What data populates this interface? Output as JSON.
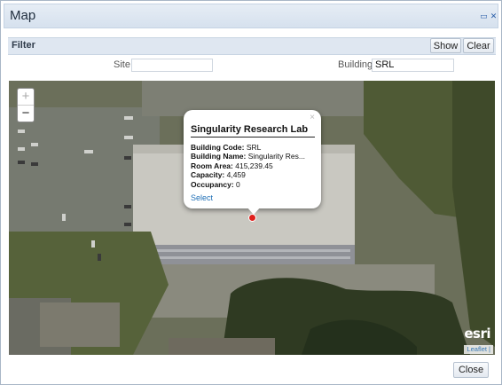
{
  "window": {
    "title": "Map",
    "restore_glyph": "▭",
    "close_glyph": "✕"
  },
  "filter": {
    "label": "Filter",
    "show_label": "Show",
    "clear_label": "Clear",
    "site_label": "Site",
    "site_value": "",
    "building_label": "Building",
    "building_value": "SRL"
  },
  "map": {
    "zoom_in": "+",
    "zoom_out": "−",
    "esri_logo": "esri",
    "attribution": "Leaflet |",
    "marker_color": "#e0201c",
    "popup": {
      "close": "×",
      "title": "Singularity Research Lab",
      "rows": [
        {
          "label": "Building Code:",
          "value": "SRL"
        },
        {
          "label": "Building Name:",
          "value": "Singularity Res..."
        },
        {
          "label": "Room Area:",
          "value": "415,239.45"
        },
        {
          "label": "Capacity:",
          "value": "4,459"
        },
        {
          "label": "Occupancy:",
          "value": "0"
        }
      ],
      "select_label": "Select"
    }
  },
  "footer": {
    "close_label": "Close"
  }
}
